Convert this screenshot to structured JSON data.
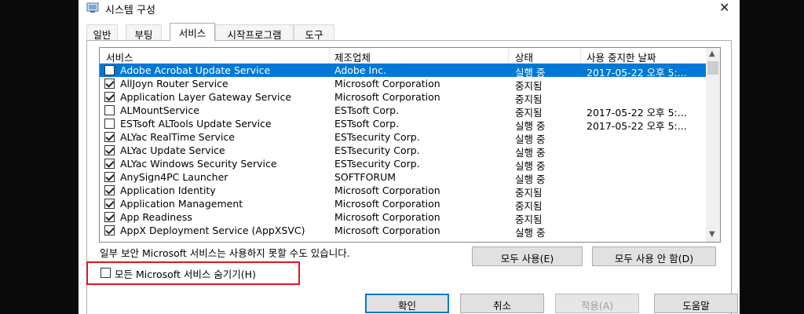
{
  "window": {
    "title": "시스템 구성",
    "close_glyph": "✕"
  },
  "tabs": [
    {
      "label": "일반",
      "active": false
    },
    {
      "label": "부팅",
      "active": false
    },
    {
      "label": "서비스",
      "active": true
    },
    {
      "label": "시작프로그램",
      "active": false
    },
    {
      "label": "도구",
      "active": false
    }
  ],
  "columns": [
    "서비스",
    "제조업체",
    "상태",
    "사용 중지한 날짜"
  ],
  "services": [
    {
      "checked": false,
      "name": "Adobe Acrobat Update Service",
      "maker": "Adobe Inc.",
      "status": "실행 중",
      "date": "2017-05-22 오후 5:...",
      "selected": true
    },
    {
      "checked": true,
      "name": "AllJoyn Router Service",
      "maker": "Microsoft Corporation",
      "status": "중지됨",
      "date": ""
    },
    {
      "checked": true,
      "name": "Application Layer Gateway Service",
      "maker": "Microsoft Corporation",
      "status": "중지됨",
      "date": ""
    },
    {
      "checked": false,
      "name": "ALMountService",
      "maker": "ESTsoft Corp.",
      "status": "중지됨",
      "date": "2017-05-22 오후 5:..."
    },
    {
      "checked": false,
      "name": "ESTsoft ALTools Update Service",
      "maker": "ESTsoft Corp.",
      "status": "실행 중",
      "date": "2017-05-22 오후 5:..."
    },
    {
      "checked": true,
      "name": "ALYac RealTime Service",
      "maker": "ESTsecurity Corp.",
      "status": "실행 중",
      "date": ""
    },
    {
      "checked": true,
      "name": "ALYac Update Service",
      "maker": "ESTsecurity Corp.",
      "status": "실행 중",
      "date": ""
    },
    {
      "checked": true,
      "name": "ALYac Windows Security Service",
      "maker": "ESTsecurity Corp.",
      "status": "실행 중",
      "date": ""
    },
    {
      "checked": true,
      "name": "AnySign4PC Launcher",
      "maker": "SOFTFORUM",
      "status": "실행 중",
      "date": ""
    },
    {
      "checked": true,
      "name": "Application Identity",
      "maker": "Microsoft Corporation",
      "status": "중지됨",
      "date": ""
    },
    {
      "checked": true,
      "name": "Application Management",
      "maker": "Microsoft Corporation",
      "status": "중지됨",
      "date": ""
    },
    {
      "checked": true,
      "name": "App Readiness",
      "maker": "Microsoft Corporation",
      "status": "중지됨",
      "date": ""
    },
    {
      "checked": true,
      "name": "AppX Deployment Service (AppXSVC)",
      "maker": "Microsoft Corporation",
      "status": "실행 중",
      "date": ""
    }
  ],
  "note": "일부 보안 Microsoft 서비스는 사용하지 못할 수도 있습니다.",
  "buttons": {
    "enable_all": "모두 사용(E)",
    "disable_all": "모두 사용 안 함(D)",
    "ok": "확인",
    "cancel": "취소",
    "apply": "적용(A)",
    "help": "도움말"
  },
  "hide_ms": {
    "label": "모든 Microsoft 서비스 숨기기(H)",
    "checked": false
  },
  "colors": {
    "selection": "#0078d7",
    "highlight_box": "#e0151b"
  }
}
